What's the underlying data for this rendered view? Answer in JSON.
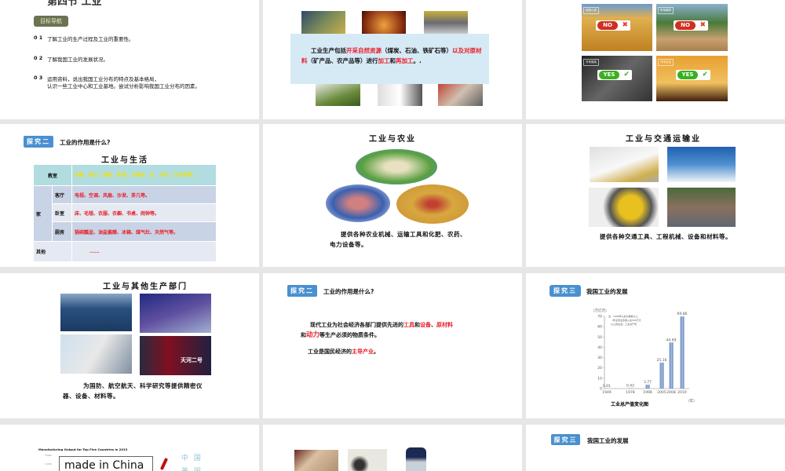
{
  "slides": [
    {
      "title": "第四节 工业",
      "badge": "目标导航",
      "goals": [
        {
          "num": "0 1",
          "text": "了解工业的生产过程及工业的重要性。"
        },
        {
          "num": "0 2",
          "text": "了解我国工业的发展状况。"
        },
        {
          "num": "0 3",
          "text": "运用资料，说出我国工业分布的特点及基本格局，",
          "text2": "认识一些工业中心和工业基地。尝试分析影响我国工业分布的因素。"
        }
      ]
    },
    {
      "p1": "工业生产包括",
      "p1r": "开采自然资源",
      "p2": "（煤炭、石油、铁矿石等）",
      "p2r": "以及对原材料",
      "p3": "（矿产品、农产品等）进行",
      "p3r": "加工",
      "p4": "和",
      "p4r": "再加工",
      "p5": "。."
    },
    {
      "tiles": [
        {
          "label": "收割小麦",
          "pill": "NO",
          "mark": "✖"
        },
        {
          "label": "采伐森林",
          "pill": "NO",
          "mark": "✖"
        },
        {
          "label": "开采煤炭",
          "pill": "YES",
          "mark": "✔"
        },
        {
          "label": "开采石油",
          "pill": "YES",
          "mark": "✔"
        }
      ]
    },
    {
      "badge": "探究二",
      "heading": "工业的作用是什么?",
      "title": "工业与生活",
      "table": {
        "classroom": "教室",
        "classroom_items": "课桌、凳子、黑板、粉笔、多媒体、灯、书本、文具等等。",
        "home": "家",
        "living": "客厅",
        "living_items": "电视、空调、风扇、沙发、茶几等。",
        "bedroom": "卧室",
        "bedroom_items": "床、毛毯、衣服、衣橱、书桌、闹钟等。",
        "kitchen": "厨房",
        "kitchen_items": "锅碗瓢盆、油盐酱醋、冰箱、煤气灶、天然气等。",
        "other": "其他",
        "other_items": "......"
      }
    },
    {
      "title": "工业与农业",
      "text1": "提供各种农业机械、运输工具和化肥、",
      "text2": "农药、电力设备等。"
    },
    {
      "title": "工业与交通运输业",
      "text1": "提供各种交通工具、工程机械、设备和",
      "text2": "材料等。"
    },
    {
      "title": "工业与其他生产部门",
      "text1": "为国防、航空航天、科学研究等提供精",
      "text2": "密仪器、设备、材料等。",
      "img_text": "天河二号"
    },
    {
      "badge": "探究二",
      "heading": "工业的作用是什么?",
      "l1a": "现代工业为社会经济各部门提供先进的",
      "l1b": "工具",
      "l1c": "和",
      "l1d": "设备",
      "l1e": "、",
      "l1f": "原材料",
      "l2a": "和",
      "l2b": "动力",
      "l2c": "等生产必须的物质条件。",
      "l3a": "工业是国民经济的",
      "l3b": "主导产业",
      "l3c": "。"
    },
    {
      "badge": "探究三",
      "heading": "我国工业的发展"
    },
    {
      "chart_title": "Manufacturing Output for Top Five Countries in 2013",
      "ticks": [
        "3,500",
        "3,000"
      ],
      "box": "made in China",
      "cn1": "中 国",
      "cn2": "美 国"
    },
    {},
    {
      "badge": "探究三",
      "heading": "我国工业的发展"
    }
  ],
  "chart_data": {
    "type": "bar",
    "title": "工业总产值变化图",
    "ylabel": "（万亿元）",
    "xlabel": "（年）",
    "categories": [
      "1949",
      "1978",
      "1998",
      "2005",
      "2008",
      "2010"
    ],
    "values": [
      0.01,
      0.42,
      3.77,
      25.16,
      44.69,
      69.86
    ],
    "value_labels": [
      "0.01",
      "0.42",
      "3.77",
      "25.16",
      "44.69",
      "69.86"
    ],
    "ylim": [
      0,
      70
    ],
    "yticks": [
      "0",
      "10",
      "20",
      "30",
      "40",
      "50",
      "60",
      "70"
    ],
    "note": [
      "注：1998年以后为规模以上",
      "（年主营业务收入在500万元",
      "以上的企业）工业总产值"
    ],
    "color": "#7f9ccc"
  }
}
